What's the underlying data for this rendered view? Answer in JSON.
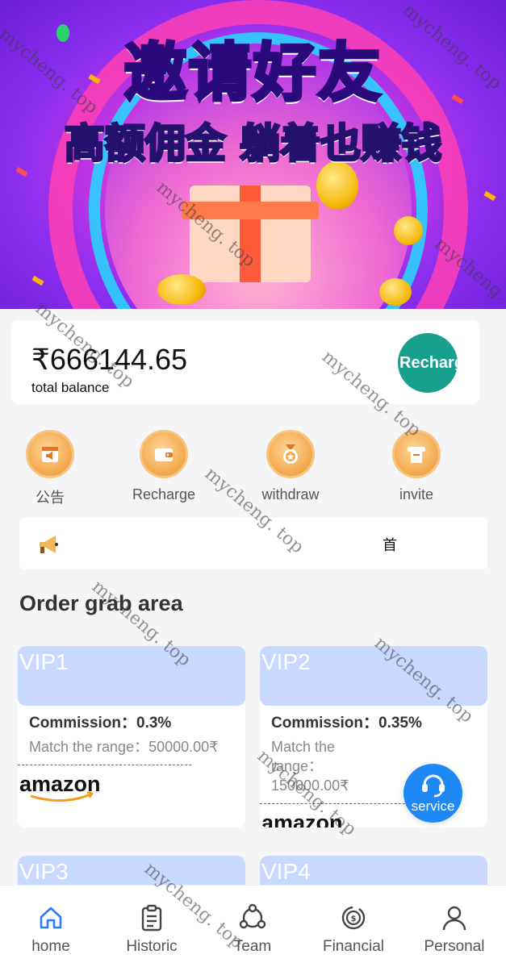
{
  "banner": {
    "title": "邀请好友",
    "subtitle": "高额佣金 躺着也赚钱"
  },
  "balance": {
    "amount": "₹666144.65",
    "label": "total balance",
    "recharge_label": "Recharge"
  },
  "quick_actions": [
    {
      "label": "公告",
      "icon": "announcement-icon"
    },
    {
      "label": "Recharge",
      "icon": "wallet-icon"
    },
    {
      "label": "withdraw",
      "icon": "medal-icon"
    },
    {
      "label": "invite",
      "icon": "atm-icon"
    }
  ],
  "notice": {
    "text": "首"
  },
  "section": {
    "title": "Order grab area"
  },
  "vips": [
    {
      "name": "VIP1",
      "commission": "Commission：0.3%",
      "range": "Match the range：50000.00₹",
      "logo": "amazon"
    },
    {
      "name": "VIP2",
      "commission": "Commission：0.35%",
      "range": "Match the range：150000.00₹",
      "logo": "amazon"
    },
    {
      "name": "VIP3"
    },
    {
      "name": "VIP4"
    }
  ],
  "service": {
    "label": "service"
  },
  "tabs": [
    {
      "label": "home",
      "icon": "home-icon",
      "active": true
    },
    {
      "label": "Historic",
      "icon": "clipboard-icon"
    },
    {
      "label": "Team",
      "icon": "team-icon"
    },
    {
      "label": "Financial",
      "icon": "financial-icon"
    },
    {
      "label": "Personal",
      "icon": "person-icon"
    }
  ],
  "watermark": "mycheng. top",
  "colors": {
    "accent": "#1e88f5",
    "recharge": "#17a08c",
    "vip_header": "#c9d8ff"
  }
}
